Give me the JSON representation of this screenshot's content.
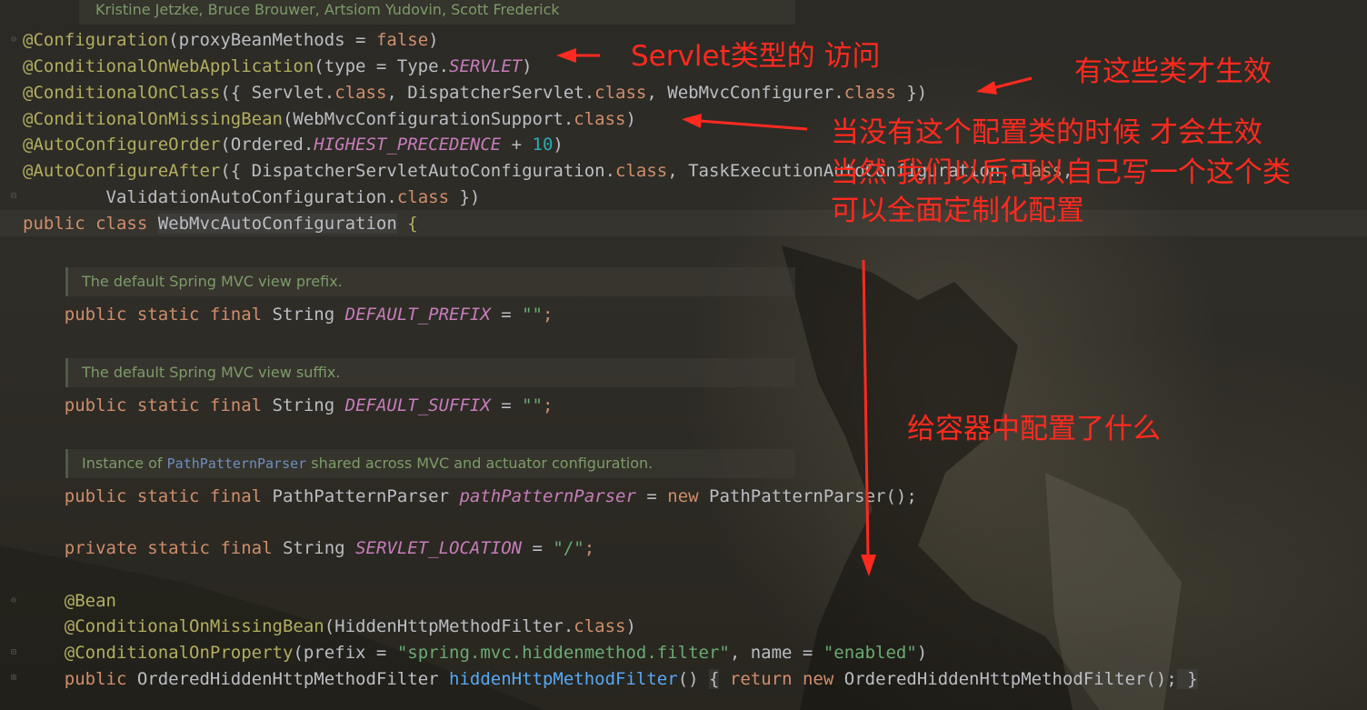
{
  "header_doc": "Kristine Jetzke, Bruce Brouwer, Artsiom Yudovin, Scott Frederick",
  "lines": {
    "l1": {
      "ann": "@Configuration",
      "p1": "(proxyBeanMethods = ",
      "kw": "false",
      "p2": ")"
    },
    "l2": {
      "ann": "@ConditionalOnWebApplication",
      "p1": "(type = Type.",
      "const": "SERVLET",
      "p2": ")"
    },
    "l3": {
      "ann": "@ConditionalOnClass",
      "p1": "({ Servlet.",
      "kw1": "class",
      "p2": ", DispatcherServlet.",
      "kw2": "class",
      "p3": ", WebMvcConfigurer.",
      "kw3": "class",
      "p4": " })"
    },
    "l4": {
      "ann": "@ConditionalOnMissingBean",
      "p1": "(WebMvcConfigurationSupport.",
      "kw": "class",
      "p2": ")"
    },
    "l5": {
      "ann": "@AutoConfigureOrder",
      "p1": "(Ordered.",
      "const": "HIGHEST_PRECEDENCE",
      "p2": " + ",
      "num": "10",
      "p3": ")"
    },
    "l6": {
      "ann": "@AutoConfigureAfter",
      "p1": "({ DispatcherServletAutoConfiguration.",
      "kw1": "class",
      "p2": ", TaskExecutionAutoConfiguration.",
      "kw2": "class",
      "p3": ","
    },
    "l7": {
      "p1": "        ValidationAutoConfiguration.",
      "kw": "class",
      "p2": " })"
    },
    "l8": {
      "kw": "public class ",
      "name": "WebMvcAutoConfiguration",
      "p1": " {"
    },
    "l9": {
      "kw": "    public static final ",
      "type": "String ",
      "field": "DEFAULT_PREFIX",
      "p1": " = ",
      "str": "\"\"",
      "p2": ";"
    },
    "l10": {
      "kw": "    public static final ",
      "type": "String ",
      "field": "DEFAULT_SUFFIX",
      "p1": " = ",
      "str": "\"\"",
      "p2": ";"
    },
    "l11": {
      "kw": "    public static final ",
      "type": "PathPatternParser ",
      "field": "pathPatternParser",
      "p1": " = ",
      "kw2": "new ",
      "p2": "PathPatternParser();"
    },
    "l12": {
      "kw": "    private static final ",
      "type": "String ",
      "field": "SERVLET_LOCATION",
      "p1": " = ",
      "str": "\"/\"",
      "p2": ";"
    },
    "l13": {
      "ann": "    @Bean"
    },
    "l14": {
      "ann": "    @ConditionalOnMissingBean",
      "p1": "(HiddenHttpMethodFilter.",
      "kw": "class",
      "p2": ")"
    },
    "l15": {
      "ann": "    @ConditionalOnProperty",
      "p1": "(prefix = ",
      "str1": "\"spring.mvc.hiddenmethod.filter\"",
      "p2": ", name = ",
      "str2": "\"enabled\"",
      "p3": ")"
    },
    "l16": {
      "kw": "    public ",
      "type": "OrderedHiddenHttpMethodFilter ",
      "fn": "hiddenHttpMethodFilter",
      "p1": "() ",
      "b1": "{",
      "kw2": " return new ",
      "p2": "OrderedHiddenHttpMethodFilter();",
      "b2": " }"
    }
  },
  "docs": {
    "prefix": "The default Spring MVC view prefix.",
    "suffix": "The default Spring MVC view suffix.",
    "ppp_a": "Instance of ",
    "ppp_code": "PathPatternParser",
    "ppp_b": " shared across MVC and actuator configuration."
  },
  "notes": {
    "servlet": "Servlet类型的 访问",
    "classes": "有这些类才生效",
    "missing1": "当没有这个配置类的时候 才会生效",
    "missing2": "当然 我们以后可以自己写一个这个类",
    "missing3": "可以全面定制化配置",
    "container": "给容器中配置了什么"
  },
  "colors": {
    "annotation": "#ff2a1f",
    "keyword": "#cf8e6d",
    "string": "#6aab73",
    "annotation_code": "#b3ae60"
  }
}
